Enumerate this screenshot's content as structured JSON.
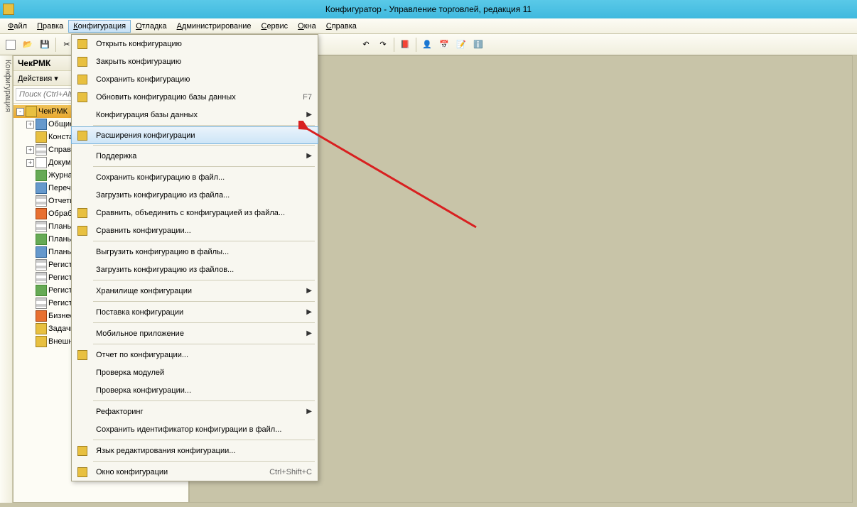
{
  "title": "Конфигуратор - Управление торговлей, редакция 11",
  "menubar": {
    "items": [
      "Файл",
      "Правка",
      "Конфигурация",
      "Отладка",
      "Администрирование",
      "Сервис",
      "Окна",
      "Справка"
    ],
    "active_index": 2
  },
  "panel": {
    "title": "ЧекРМК",
    "actions_label": "Действия ▾",
    "search_placeholder": "Поиск (Ctrl+Alt+",
    "tree": [
      {
        "label": "ЧекРМК",
        "icon": "ico-yellow",
        "selected": true,
        "exp": "-"
      },
      {
        "label": "Общие",
        "icon": "ico-blue",
        "child": true,
        "exp": "+"
      },
      {
        "label": "Конста",
        "icon": "ico-yellow",
        "child": true,
        "exp": ""
      },
      {
        "label": "Справо",
        "icon": "ico-table",
        "child": true,
        "exp": "+"
      },
      {
        "label": "Докуме",
        "icon": "ico-doc",
        "child": true,
        "exp": "+"
      },
      {
        "label": "Журна",
        "icon": "ico-green",
        "child": true,
        "exp": ""
      },
      {
        "label": "Перечи",
        "icon": "ico-blue",
        "child": true,
        "exp": ""
      },
      {
        "label": "Отчеты",
        "icon": "ico-table",
        "child": true,
        "exp": ""
      },
      {
        "label": "Обрабо",
        "icon": "ico-orange",
        "child": true,
        "exp": ""
      },
      {
        "label": "Планы",
        "icon": "ico-table",
        "child": true,
        "exp": ""
      },
      {
        "label": "Планы",
        "icon": "ico-green",
        "child": true,
        "exp": ""
      },
      {
        "label": "Планы",
        "icon": "ico-blue",
        "child": true,
        "exp": ""
      },
      {
        "label": "Регист",
        "icon": "ico-table",
        "child": true,
        "exp": ""
      },
      {
        "label": "Регист",
        "icon": "ico-table",
        "child": true,
        "exp": ""
      },
      {
        "label": "Регист",
        "icon": "ico-green",
        "child": true,
        "exp": ""
      },
      {
        "label": "Регист",
        "icon": "ico-table",
        "child": true,
        "exp": ""
      },
      {
        "label": "Бизнес",
        "icon": "ico-orange",
        "child": true,
        "exp": ""
      },
      {
        "label": "Задачи",
        "icon": "ico-yellow",
        "child": true,
        "exp": ""
      },
      {
        "label": "Внешни",
        "icon": "ico-yellow",
        "child": true,
        "exp": ""
      }
    ]
  },
  "sidebar_vert": "Конфигурация",
  "dropdown": {
    "items": [
      {
        "label": "Открыть конфигурацию",
        "icon": true
      },
      {
        "label": "Закрыть конфигурацию",
        "icon": true
      },
      {
        "label": "Сохранить конфигурацию",
        "icon": true
      },
      {
        "label": "Обновить конфигурацию базы данных",
        "icon": true,
        "shortcut": "F7"
      },
      {
        "label": "Конфигурация базы данных",
        "submenu": true
      },
      {
        "sep": true
      },
      {
        "label": "Расширения конфигурации",
        "icon": true,
        "highlighted": true
      },
      {
        "sep": true
      },
      {
        "label": "Поддержка",
        "submenu": true
      },
      {
        "sep": true
      },
      {
        "label": "Сохранить конфигурацию в файл..."
      },
      {
        "label": "Загрузить конфигурацию из файла..."
      },
      {
        "label": "Сравнить, объединить с конфигурацией из файла...",
        "icon": true
      },
      {
        "label": "Сравнить конфигурации...",
        "icon": true
      },
      {
        "sep": true
      },
      {
        "label": "Выгрузить конфигурацию в файлы..."
      },
      {
        "label": "Загрузить конфигурацию из файлов..."
      },
      {
        "sep": true
      },
      {
        "label": "Хранилище конфигурации",
        "submenu": true
      },
      {
        "sep": true
      },
      {
        "label": "Поставка конфигурации",
        "submenu": true
      },
      {
        "sep": true
      },
      {
        "label": "Мобильное приложение",
        "submenu": true
      },
      {
        "sep": true
      },
      {
        "label": "Отчет по конфигурации...",
        "icon": true
      },
      {
        "label": "Проверка модулей"
      },
      {
        "label": "Проверка конфигурации..."
      },
      {
        "sep": true
      },
      {
        "label": "Рефакторинг",
        "submenu": true
      },
      {
        "label": "Сохранить идентификатор конфигурации в файл..."
      },
      {
        "sep": true
      },
      {
        "label": "Язык редактирования конфигурации...",
        "icon": true
      },
      {
        "sep": true
      },
      {
        "label": "Окно конфигурации",
        "icon": true,
        "shortcut": "Ctrl+Shift+C"
      }
    ]
  }
}
